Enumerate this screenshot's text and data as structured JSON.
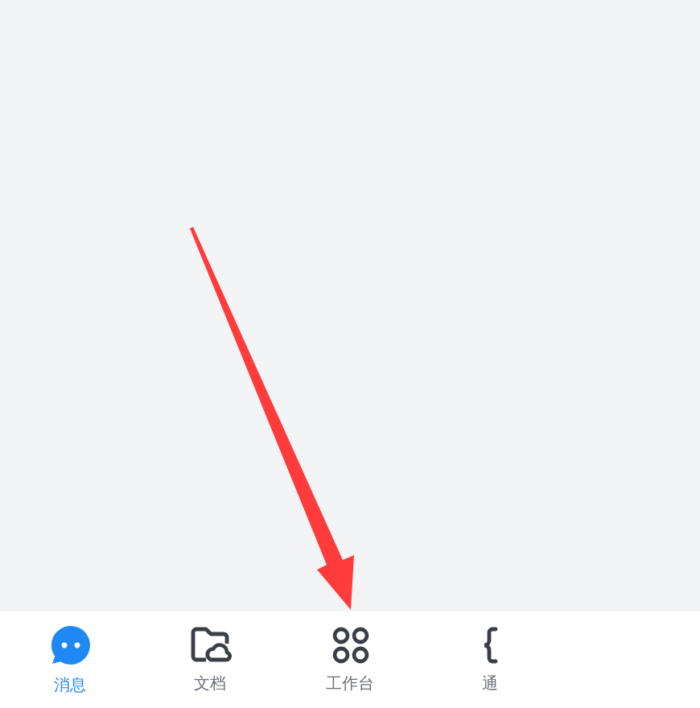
{
  "tab_bar": {
    "tabs": [
      {
        "label": "消息",
        "selected": true
      },
      {
        "label": "文档",
        "selected": false
      },
      {
        "label": "工作台",
        "selected": false
      },
      {
        "label": "通",
        "selected": false
      }
    ]
  }
}
